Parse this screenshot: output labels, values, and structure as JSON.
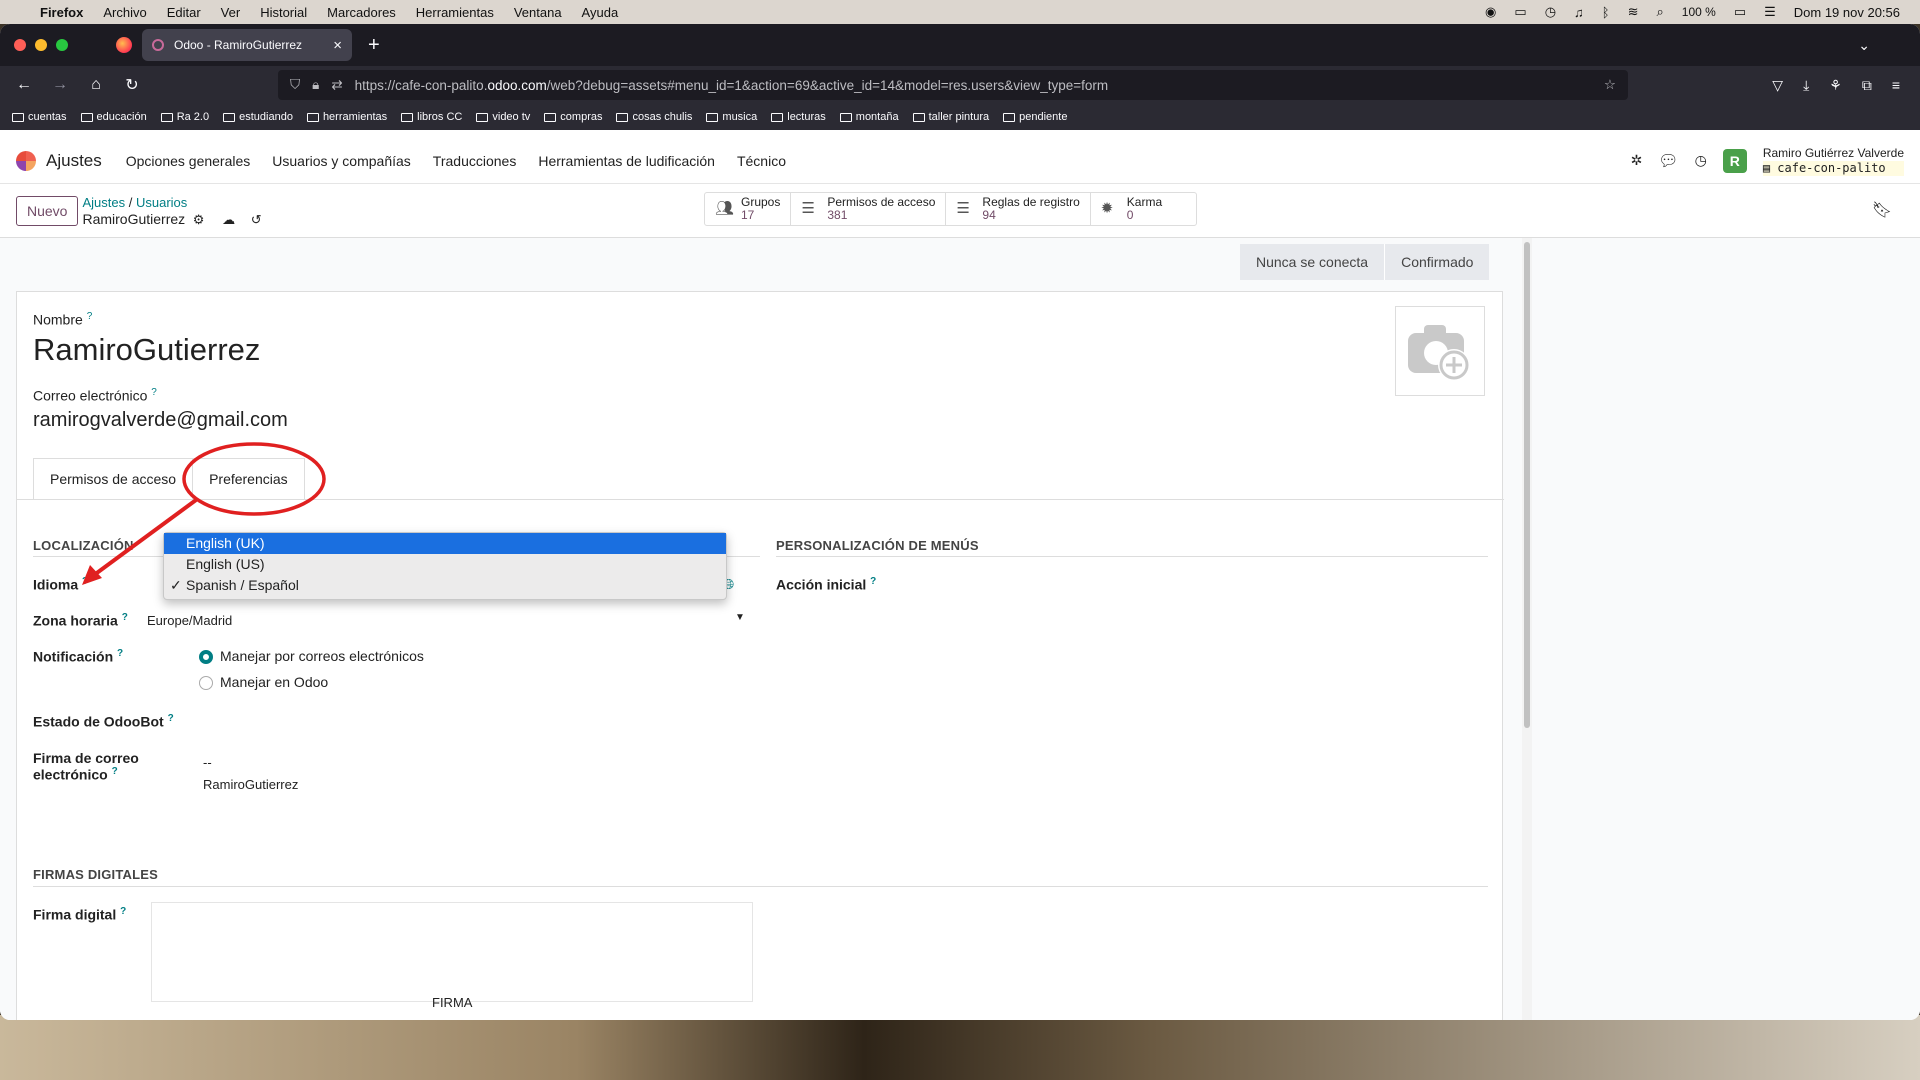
{
  "macbar": {
    "app": "Firefox",
    "menus": [
      "Archivo",
      "Editar",
      "Ver",
      "Historial",
      "Marcadores",
      "Herramientas",
      "Ventana",
      "Ayuda"
    ],
    "battery": "100 %",
    "datetime": "Dom 19 nov  20:56"
  },
  "browser": {
    "tab_title": "Odoo - RamiroGutierrez",
    "url_pre": "https://cafe-con-palito.",
    "url_host": "odoo.com",
    "url_post": "/web?debug=assets#menu_id=1&action=69&active_id=14&model=res.users&view_type=form",
    "bookmarks": [
      "cuentas",
      "educación",
      "Ra 2.0",
      "estudiando",
      "herramientas",
      "libros CC",
      "video tv",
      "compras",
      "cosas chulis",
      "musica",
      "lecturas",
      "montaña",
      "taller pintura",
      "pendiente"
    ]
  },
  "odoo": {
    "app": "Ajustes",
    "menu": [
      "Opciones generales",
      "Usuarios y compañías",
      "Traducciones",
      "Herramientas de ludificación",
      "Técnico"
    ],
    "user_name": "Ramiro Gutiérrez Valverde",
    "db": "cafe-con-palito",
    "avatar_letter": "R",
    "new_button": "Nuevo",
    "breadcrumb": {
      "root": "Ajustes",
      "sep": "/",
      "parent": "Usuarios",
      "current": "RamiroGutierrez"
    },
    "stats": [
      {
        "label": "Grupos",
        "value": "17"
      },
      {
        "label": "Permisos de acceso",
        "value": "381"
      },
      {
        "label": "Reglas de registro",
        "value": "94"
      },
      {
        "label": "Karma",
        "value": "0"
      }
    ],
    "status": [
      "Nunca se conecta",
      "Confirmado"
    ],
    "form": {
      "name_label": "Nombre",
      "name": "RamiroGutierrez",
      "email_label": "Correo electrónico",
      "email": "ramirogvalverde@gmail.com",
      "tabs": [
        "Permisos de acceso",
        "Preferencias"
      ],
      "sec_loc": "LOCALIZACIÓN",
      "sec_menu": "PERSONALIZACIÓN DE MENÚS",
      "sec_sign": "FIRMAS DIGITALES",
      "lang_label": "Idioma",
      "tz_label": "Zona horaria",
      "tz_value": "Europe/Madrid",
      "notif_label": "Notificación",
      "notif_opts": [
        "Manejar por correos electrónicos",
        "Manejar en Odoo"
      ],
      "odoobot_label": "Estado de OdooBot",
      "sig_label1": "Firma de correo",
      "sig_label2": "electrónico",
      "sig_line1": "--",
      "sig_line2": "RamiroGutierrez",
      "action_label": "Acción inicial",
      "digital_label": "Firma digital",
      "digital_box": "FIRMA",
      "q": "?"
    },
    "lang_options": [
      {
        "label": "English (UK)",
        "highlighted": true,
        "checked": false
      },
      {
        "label": "English (US)",
        "highlighted": false,
        "checked": false
      },
      {
        "label": "Spanish / Español",
        "highlighted": false,
        "checked": true
      }
    ]
  },
  "annotation_color": "#e02020"
}
